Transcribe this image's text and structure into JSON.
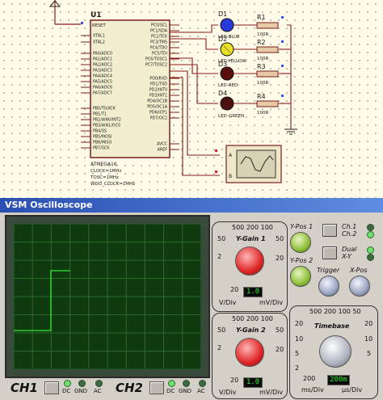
{
  "schematic": {
    "chip": {
      "ref": "U1",
      "part": "ATMEGA16",
      "props": [
        "CLOCK=1MHz",
        "TOSC=1MHz",
        "WDO_CLOCK=1MHz"
      ],
      "pin_reset": "RESET",
      "left_pins": [
        "XTAL1",
        "XTAL2",
        "PA0/ADC0",
        "PA1/ADC1",
        "PA2/ADC2",
        "PA3/ADC3",
        "PA4/ADC4",
        "PA5/ADC5",
        "PA6/ADC6",
        "PA7/ADC7",
        "PB0/T0/XCK",
        "PB1/T1",
        "PB2/AIN0/INT2",
        "PB3/AIN1/OC0",
        "PB4/SS",
        "PB5/MOSI",
        "PB6/MISO",
        "PB7/SCK"
      ],
      "right_pins": [
        "PC0/SCL",
        "PC1/SDA",
        "PC2/TCK",
        "PC3/TMS",
        "PC4/TDO",
        "PC5/TDI",
        "PC6/TOSC1",
        "PC7/TOSC2",
        "PD0/RXD",
        "PD1/TXD",
        "PD2/INT0",
        "PD3/INT1",
        "PD4/OC1B",
        "PD5/OC1A",
        "PD6/ICP1",
        "PD7/OC2",
        "AVCC",
        "AREF"
      ]
    },
    "leds": [
      {
        "ref": "D1",
        "name": "LED-BLUE",
        "color": "#2a3ad8"
      },
      {
        "ref": "D2",
        "name": "LED-YELLOW",
        "color": "#e8e020"
      },
      {
        "ref": "D3",
        "name": "LED-RED",
        "color": "#5a0f0f"
      },
      {
        "ref": "D4",
        "name": "LED-GREEN",
        "color": "#4a0f0f"
      }
    ],
    "resistors": [
      {
        "ref": "R1",
        "value": "100R"
      },
      {
        "ref": "R2",
        "value": "100R"
      },
      {
        "ref": "R3",
        "value": "100R"
      },
      {
        "ref": "R4",
        "value": "100R"
      }
    ],
    "scope_channels": [
      "A",
      "B"
    ]
  },
  "oscilloscope": {
    "title": "VSM Oscilloscope",
    "ch1": {
      "label": "CH1",
      "dc": "DC",
      "gnd": "GND",
      "ac": "AC"
    },
    "ch2": {
      "label": "CH2",
      "dc": "DC",
      "gnd": "GND",
      "ac": "AC"
    },
    "ygain1": {
      "title": "Y-Gain 1",
      "scale_top": "500 200 100",
      "left_50": "50",
      "right_50": "50",
      "left_2": "2",
      "right_20": "20",
      "bottom_20": "20",
      "display": "1.0",
      "unit_left": "V/Div",
      "unit_right": "mV/Div"
    },
    "ygain2": {
      "title": "Y-Gain 2",
      "scale_top": "500 200 100",
      "left_50": "50",
      "right_50": "50",
      "left_2": "2",
      "right_20": "20",
      "bottom_20": "20",
      "display": "1.0",
      "unit_left": "V/Div",
      "unit_right": "mV/Div"
    },
    "timebase": {
      "title": "Timebase",
      "scale_top": "500 200 100 50",
      "left_20": "20",
      "right_20": "20",
      "left_10": "10",
      "right_10": "10",
      "left_5": "5",
      "right_5": "5",
      "left_2": "2",
      "bottom": "200",
      "display": "200m",
      "unit_left": "ms/Div",
      "unit_right": "µs/Div"
    },
    "ypos1": "Y-Pos 1",
    "ypos2": "Y-Pos 2",
    "trigger": "Trigger",
    "xpos": "X-Pos",
    "btn_ch1": "Ch.1",
    "btn_ch2": "Ch.2",
    "btn_dual": "Dual",
    "btn_xy": "X-Y",
    "colors": {
      "trace": "#2ecc2e",
      "grid": "#2a6a2a",
      "screen": "#0f3a10"
    }
  }
}
